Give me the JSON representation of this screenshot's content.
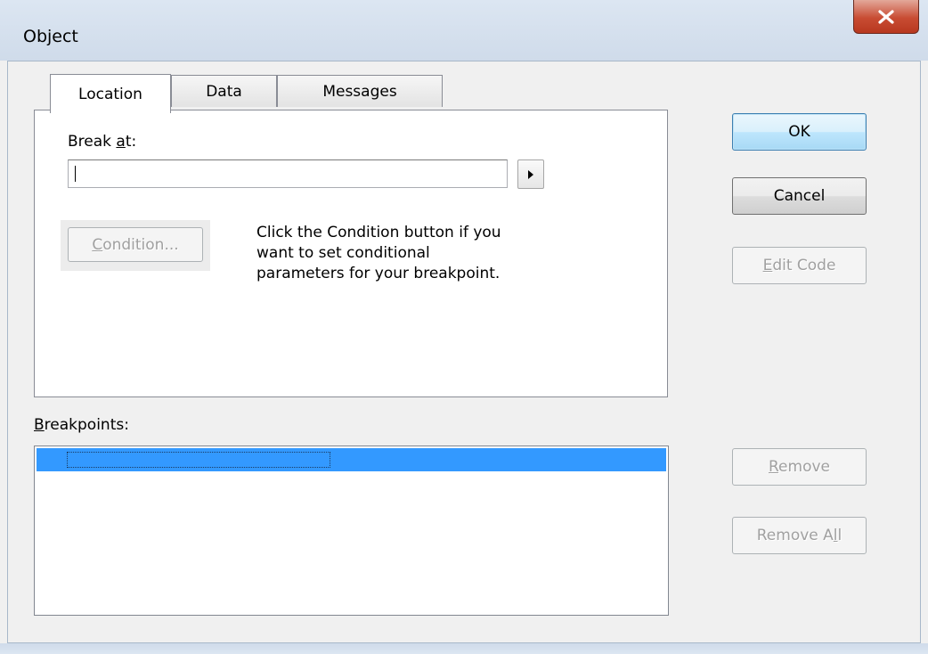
{
  "window": {
    "title": "Object"
  },
  "tabs": [
    {
      "label": "Location",
      "active": true
    },
    {
      "label": "Data",
      "active": false
    },
    {
      "label": "Messages",
      "active": false
    }
  ],
  "location": {
    "break_at_label_pre": "Break ",
    "break_at_label_ul": "a",
    "break_at_label_post": "t:",
    "break_at_value": "",
    "condition_button_pre": "",
    "condition_button_ul": "C",
    "condition_button_post": "ondition...",
    "help_line1": "Click the Condition button if you",
    "help_line2": "want to set conditional",
    "help_line3": "parameters for your breakpoint."
  },
  "breakpoints": {
    "label_ul": "B",
    "label_post": "reakpoints:",
    "items": [
      ""
    ]
  },
  "buttons": {
    "ok": "OK",
    "cancel": "Cancel",
    "edit_code_ul": "E",
    "edit_code_post": "dit Code",
    "remove_ul": "R",
    "remove_post": "emove",
    "remove_all_pre": "Remove A",
    "remove_all_ul": "l",
    "remove_all_post": "l"
  },
  "colors": {
    "selection": "#3399ff",
    "close_button": "#c84c33"
  },
  "icons": {
    "close": "close-x-icon",
    "dropdown": "right-triangle-arrow-icon"
  }
}
